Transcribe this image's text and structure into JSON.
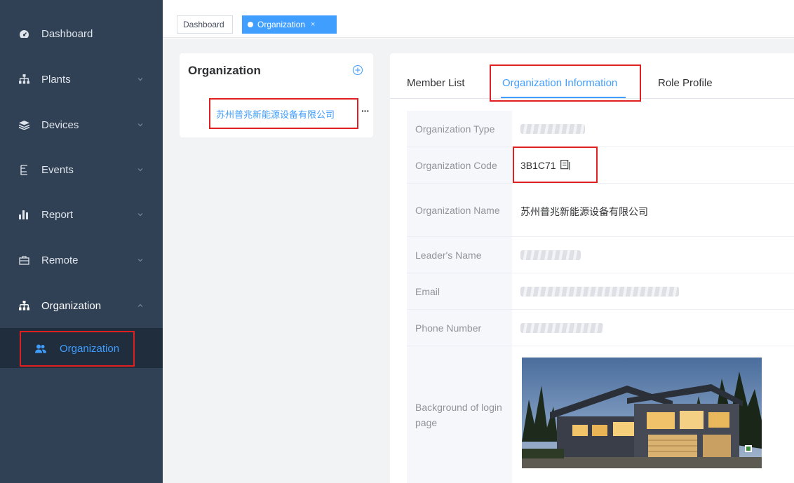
{
  "sidebar": {
    "items": [
      {
        "label": "Dashboard",
        "icon": "dashboard-icon",
        "expandable": false
      },
      {
        "label": "Plants",
        "icon": "sitemap-icon",
        "expandable": true,
        "expanded": false
      },
      {
        "label": "Devices",
        "icon": "layers-icon",
        "expandable": true,
        "expanded": false
      },
      {
        "label": "Events",
        "icon": "events-icon",
        "expandable": true,
        "expanded": false
      },
      {
        "label": "Report",
        "icon": "bar-chart-icon",
        "expandable": true,
        "expanded": false
      },
      {
        "label": "Remote",
        "icon": "remote-icon",
        "expandable": true,
        "expanded": false
      },
      {
        "label": "Organization",
        "icon": "sitemap-icon",
        "expandable": true,
        "expanded": true
      }
    ],
    "submenu": {
      "label": "Organization",
      "icon": "users-icon",
      "active": true
    }
  },
  "tags": {
    "dashboard": "Dashboard",
    "organization": "Organization",
    "close": "×"
  },
  "org_tree": {
    "title": "Organization",
    "node": "苏州普兆新能源设备有限公司",
    "more": "···"
  },
  "tabs": {
    "member_list": "Member List",
    "org_info": "Organization Information",
    "role_profile": "Role Profile",
    "active": "org_info"
  },
  "info": {
    "rows": [
      {
        "label": "Organization Type",
        "value": ""
      },
      {
        "label": "Organization Code",
        "value": "3B1C71"
      },
      {
        "label": "Organization Name",
        "value": "苏州普兆新能源设备有限公司"
      },
      {
        "label": "Leader's Name",
        "value": ""
      },
      {
        "label": "Email",
        "value": ""
      },
      {
        "label": "Phone Number",
        "value": ""
      },
      {
        "label": "Background of login page",
        "value": ""
      }
    ]
  },
  "colors": {
    "sidebar_bg": "#304156",
    "accent": "#409eff",
    "highlight_box": "#e02020"
  }
}
